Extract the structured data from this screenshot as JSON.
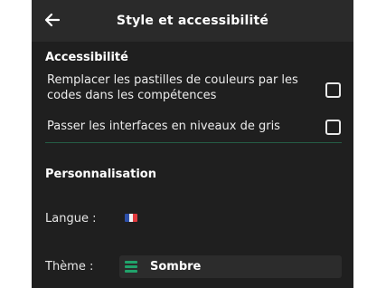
{
  "header": {
    "title": "Style et accessibilité",
    "back_icon": "arrow-left-icon"
  },
  "accessibility": {
    "title": "Accessibilité",
    "options": [
      {
        "line1": "Remplacer les pastilles de couleurs par les",
        "line2": "codes dans les compétences",
        "checked": false
      },
      {
        "line1": "Passer les interfaces en niveaux de gris",
        "checked": false
      }
    ]
  },
  "personalisation": {
    "title": "Personnalisation",
    "language_label": "Langue :",
    "language_flag_icon": "french-flag-icon",
    "theme_label": "Thème :",
    "theme_value": "Sombre",
    "theme_icon": "menu-lines-icon"
  },
  "colors": {
    "background": "#1f1f1f",
    "header": "#2a2a2a",
    "accent": "#21a36b",
    "divider": "#245c45"
  }
}
